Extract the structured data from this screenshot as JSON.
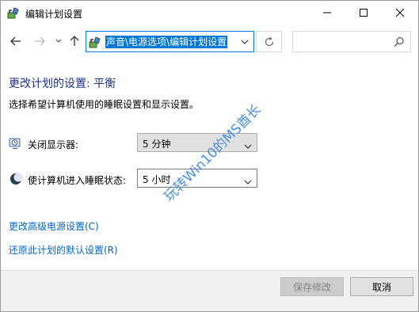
{
  "window": {
    "title": "编辑计划设置"
  },
  "addressbar": {
    "path": "声音\\电源选项\\编辑计划设置",
    "search_placeholder": ""
  },
  "main": {
    "heading": "更改计划的设置: 平衡",
    "subtext": "选择希望计算机使用的睡眠设置和显示设置。",
    "settings": [
      {
        "label": "关闭显示器:",
        "value": "5 分钟",
        "icon": "monitor-clock-icon"
      },
      {
        "label": "使计算机进入睡眠状态:",
        "value": "5 小时",
        "icon": "sleep-moon-icon"
      }
    ],
    "links": {
      "advanced": "更改高级电源设置(C)",
      "restore": "还原此计划的默认设置(R)"
    },
    "watermark": "玩转Win10的MS酋长"
  },
  "footer": {
    "save_label": "保存修改",
    "cancel_label": "取消"
  },
  "colors": {
    "accent": "#0078d7",
    "heading": "#1e3287",
    "link": "#0066cc"
  }
}
